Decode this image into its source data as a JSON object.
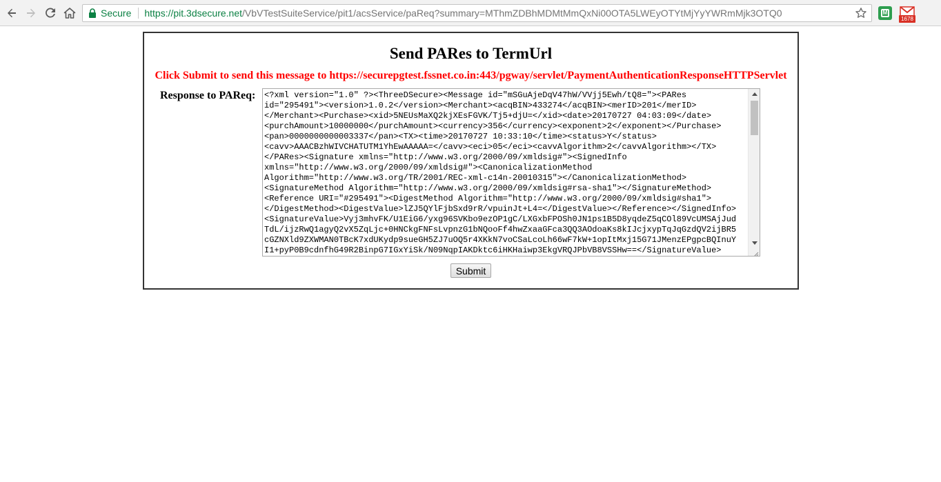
{
  "browser": {
    "secure_label": "Secure",
    "url_scheme_host": "https://pit.3dsecure.net",
    "url_path": "/VbVTestSuiteService/pit1/acsService/paReq?summary=MThmZDBhMDMtMmQxNi00OTA5LWEyOTYtMjYyYWRmMjk3OTQ0",
    "mail_badge": "1678"
  },
  "page": {
    "title": "Send PARes to TermUrl",
    "instruction": "Click Submit to send this message to https://securepgtest.fssnet.co.in:443/pgway/servlet/PaymentAuthenticationResponseHTTPServlet",
    "response_label": "Response to PAReq:",
    "response_lines": [
      "<?xml version=\"1.0\" ?><ThreeDSecure><Message id=\"mSGuAjeDqV47hW/VVjj5Ewh/tQ8=\"><PARes",
      "id=\"295491\"><version>1.0.2</version><Merchant><acqBIN>433274</acqBIN><merID>201</merID>",
      "</Merchant><Purchase><xid>5NEUsMaXQ2kjXEsFGVK/Tj5+djU=</xid><date>20170727 04:03:09</date>",
      "<purchAmount>10000000</purchAmount><currency>356</currency><exponent>2</exponent></Purchase>",
      "<pan>0000000000003337</pan><TX><time>20170727 10:33:10</time><status>Y</status>",
      "<cavv>AAACBzhWIVCHATUTM1YhEwAAAAA=</cavv><eci>05</eci><cavvAlgorithm>2</cavvAlgorithm></TX>",
      "</PARes><Signature xmlns=\"http://www.w3.org/2000/09/xmldsig#\"><SignedInfo",
      "xmlns=\"http://www.w3.org/2000/09/xmldsig#\"><CanonicalizationMethod",
      "Algorithm=\"http://www.w3.org/TR/2001/REC-xml-c14n-20010315\"></CanonicalizationMethod>",
      "<SignatureMethod Algorithm=\"http://www.w3.org/2000/09/xmldsig#rsa-sha1\"></SignatureMethod>",
      "<Reference URI=\"#295491\"><DigestMethod Algorithm=\"http://www.w3.org/2000/09/xmldsig#sha1\">",
      "</DigestMethod><DigestValue>lZJ5QYlFjbSxd9rR/vpuinJt+L4=</DigestValue></Reference></SignedInfo>",
      "<SignatureValue>Vyj3mhvFK/U1EiG6/yxg96SVKbo9ezOP1gC/LXGxbFPOSh0JN1ps1B5D8yqdeZ5qCOl89VcUMSAjJud",
      "TdL/ijzRwQ1agyQ2vX5ZqLjc+0HNCkgFNFsLvpnzG1bNQooFf4hwZxaaGFca3QQ3AOdoaKs8kIJcjxypTqJqGzdQV2ijBR5",
      "cGZNXld9ZXWMAN0TBcK7xdUKydp9sueGH5ZJ7uOQ5r4XKkN7voCSaLcoLh66wF7kW+1opItMxj15G71JMenzEPgpcBQInuY",
      "I1+pyP0B9cdnfhG49R2BinpG7IGxYiSk/N09NqpIAKDktc6iHKHaiwp3EkgVRQJPbVB8VSSHw==</SignatureValue>"
    ],
    "submit_label": "Submit"
  }
}
